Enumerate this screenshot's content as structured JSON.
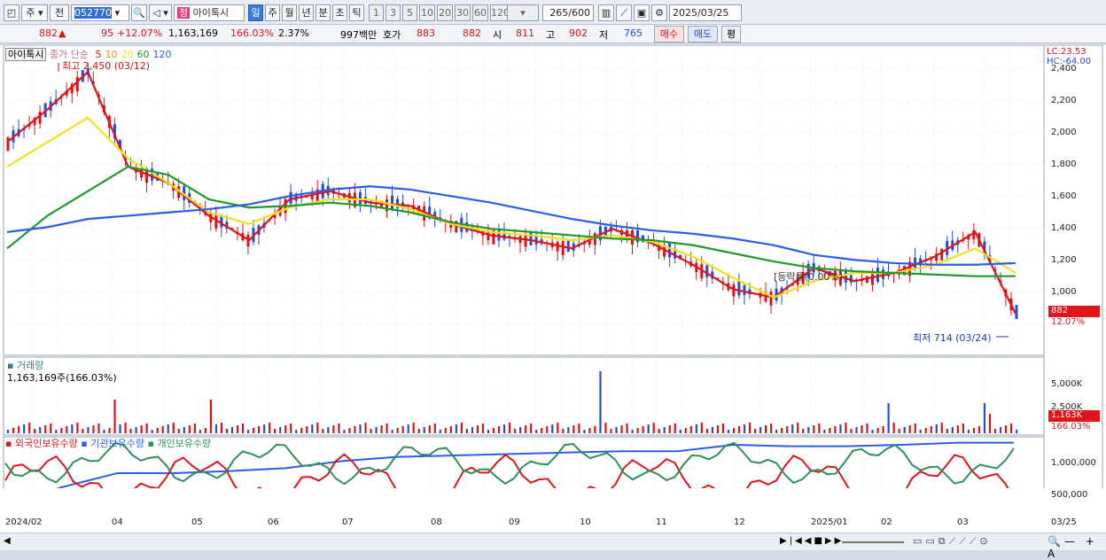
{
  "toolbar": {
    "market": "주",
    "prev": "전",
    "code": "052770",
    "name": "아이톡시",
    "periods": [
      "일",
      "주",
      "월",
      "년",
      "분",
      "초",
      "틱"
    ],
    "active_period": "일",
    "intervals": [
      "1",
      "3",
      "5",
      "10",
      "20",
      "30",
      "60",
      "120"
    ],
    "count": "265",
    "total": "/600",
    "date": "2025/03/25"
  },
  "quote": {
    "price": "882",
    "arrow": "▲",
    "change": "95",
    "change_pct": "+12.07%",
    "volume": "1,163,169",
    "vol_ratio": "166.03%",
    "turnover": "2.37%",
    "amount": "997백만",
    "hoga_label": "호가",
    "ask": "883",
    "bid": "882",
    "open_label": "시",
    "open": "811",
    "high_label": "고",
    "high": "902",
    "low_label": "저",
    "low": "765",
    "buy": "매수",
    "sell": "매도",
    "eval": "평"
  },
  "price_panel": {
    "title": "아이톡시",
    "ma_label": "종가 단순",
    "ma_periods": [
      "5",
      "10",
      "20",
      "60",
      "120"
    ],
    "ma_colors": [
      "#e0141b",
      "#f08c1e",
      "#f0e01e",
      "#1e9a2e",
      "#2a5ee8"
    ],
    "high_note": "최고 2,450 (03/12)",
    "low_note": "최저 714 (03/24)",
    "lc": "LC:23.53",
    "hc": "HC:-64.00",
    "y_ticks": [
      "2,400",
      "2,200",
      "2,000",
      "1,800",
      "1,600",
      "1,400",
      "1,200",
      "1,000"
    ],
    "price_tag": "882",
    "pct_tag": "12.07%",
    "note_mid": "[등락률(0.00%)"
  },
  "volume_panel": {
    "title": "거래량",
    "value": "1,163,169주(166.03%)",
    "y_ticks": [
      "5,000K",
      "2,500K"
    ],
    "tag": "1,163K",
    "tag2": "166.03%"
  },
  "holding_panel": {
    "legend": [
      "외국인보유수량",
      "기관보유수량",
      "개인보유수량"
    ],
    "colors": [
      "#e0141b",
      "#2a5ee8",
      "#2f8f5a"
    ],
    "y_ticks": [
      "1,000,000",
      "500,000"
    ]
  },
  "x_labels": [
    "2024/02",
    "04",
    "05",
    "06",
    "07",
    "08",
    "09",
    "10",
    "11",
    "12",
    "2025/01",
    "02",
    "03",
    "03/25"
  ],
  "chart_data": {
    "type": "line",
    "series": [
      {
        "name": "5",
        "values": [
          1950,
          2150,
          2380,
          1800,
          1700,
          1500,
          1350,
          1600,
          1650,
          1580,
          1560,
          1450,
          1380,
          1350,
          1300,
          1420,
          1330,
          1200,
          1050,
          1000,
          1180,
          1100,
          1150,
          1250,
          1400,
          900
        ]
      },
      {
        "name": "20",
        "values": [
          1800,
          1950,
          2100,
          1850,
          1700,
          1520,
          1450,
          1550,
          1600,
          1600,
          1540,
          1450,
          1400,
          1380,
          1350,
          1380,
          1340,
          1250,
          1120,
          1000,
          1100,
          1150,
          1150,
          1200,
          1300,
          1150
        ]
      },
      {
        "name": "60",
        "values": [
          1300,
          1500,
          1650,
          1800,
          1750,
          1600,
          1550,
          1560,
          1580,
          1560,
          1520,
          1460,
          1420,
          1400,
          1380,
          1360,
          1350,
          1320,
          1270,
          1220,
          1180,
          1160,
          1150,
          1140,
          1130,
          1130
        ]
      },
      {
        "name": "120",
        "values": [
          1400,
          1430,
          1480,
          1500,
          1520,
          1540,
          1570,
          1620,
          1660,
          1680,
          1660,
          1620,
          1580,
          1530,
          1480,
          1440,
          1410,
          1390,
          1360,
          1320,
          1260,
          1230,
          1210,
          1200,
          1200,
          1210
        ]
      }
    ]
  }
}
